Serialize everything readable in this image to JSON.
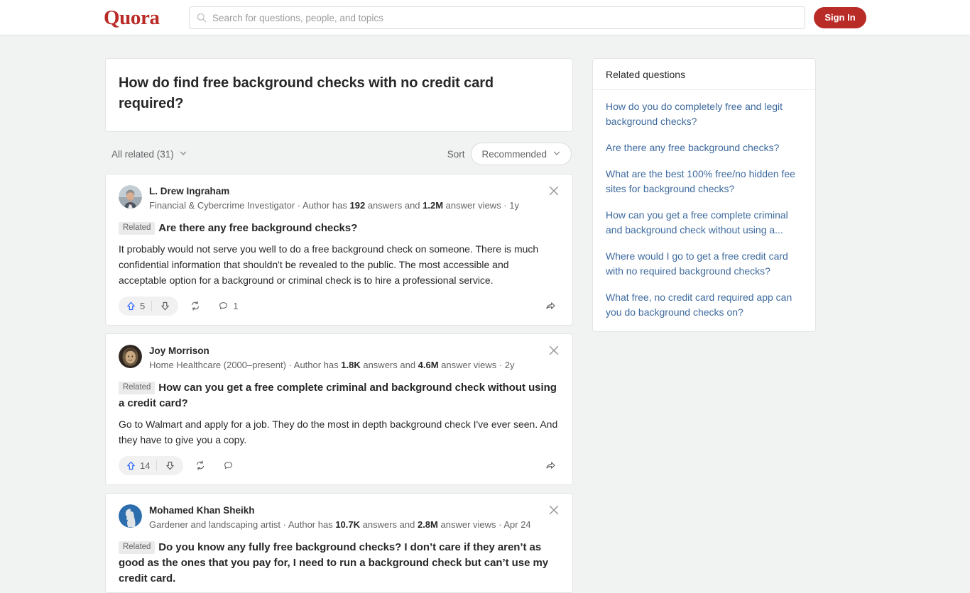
{
  "header": {
    "logo_text": "Quora",
    "search": {
      "placeholder": "Search for questions, people, and topics",
      "value": "",
      "icon": "search-icon"
    },
    "signin_label": "Sign In"
  },
  "question": {
    "title": "How do find free background checks with no credit card required?"
  },
  "filters": {
    "all_related_label": "All related (31)",
    "sort_label": "Sort",
    "sort_value": "Recommended"
  },
  "answers": [
    {
      "author_name": "L. Drew Ingraham",
      "credential_prefix": "Financial & Cybercrime Investigator · Author has ",
      "answers_count": "192",
      "credential_mid": " answers and ",
      "views_count": "1.2M",
      "credential_suffix": " answer views · 1y",
      "related_badge": "Related",
      "related_question": "Are there any free background checks?",
      "body": "It probably would not serve you well to do a free background check on someone. There is much confidential information that shouldn't be revealed to the public. The most accessible and acceptable option for a background or criminal check is to hire a professional service.",
      "upvotes": "5",
      "comments": "1",
      "avatar_type": "photo-man",
      "close_icon": "close-icon"
    },
    {
      "author_name": "Joy Morrison",
      "credential_prefix": "Home Healthcare (2000–present) · Author has ",
      "answers_count": "1.8K",
      "credential_mid": " answers and ",
      "views_count": "4.6M",
      "credential_suffix": " answer views · 2y",
      "related_badge": "Related",
      "related_question": "How can you get a free complete criminal and background check without using a credit card?",
      "body": "Go to Walmart and apply for a job. They do the most in depth background check I've ever seen. And they have to give you a copy.",
      "upvotes": "14",
      "comments": "",
      "avatar_type": "photo-woman",
      "close_icon": "close-icon"
    },
    {
      "author_name": "Mohamed Khan Sheikh",
      "credential_prefix": "Gardener and landscaping artist · Author has ",
      "answers_count": "10.7K",
      "credential_mid": " answers and ",
      "views_count": "2.8M",
      "credential_suffix": " answer views · Apr 24",
      "related_badge": "Related",
      "related_question": "Do you know any fully free background checks? I don’t care if they aren’t as good as the ones that you pay for, I need to run a background check but can’t use my credit card.",
      "body": "",
      "upvotes": "",
      "comments": "",
      "avatar_type": "default-blue",
      "close_icon": "close-icon"
    }
  ],
  "sidebar": {
    "header": "Related questions",
    "links": [
      "How do you do completely free and legit background checks?",
      "Are there any free background checks?",
      "What are the best 100% free/no hidden fee sites for background checks?",
      "How can you get a free complete criminal and background check without using a...",
      "Where would I go to get a free credit card with no required background checks?",
      "What free, no credit card required app can you do background checks on?"
    ]
  },
  "colors": {
    "brand_red": "#b92b27",
    "upvote_blue": "#2e69ff",
    "link_blue": "#3d6a9e",
    "page_bg": "#f1f2f2"
  }
}
